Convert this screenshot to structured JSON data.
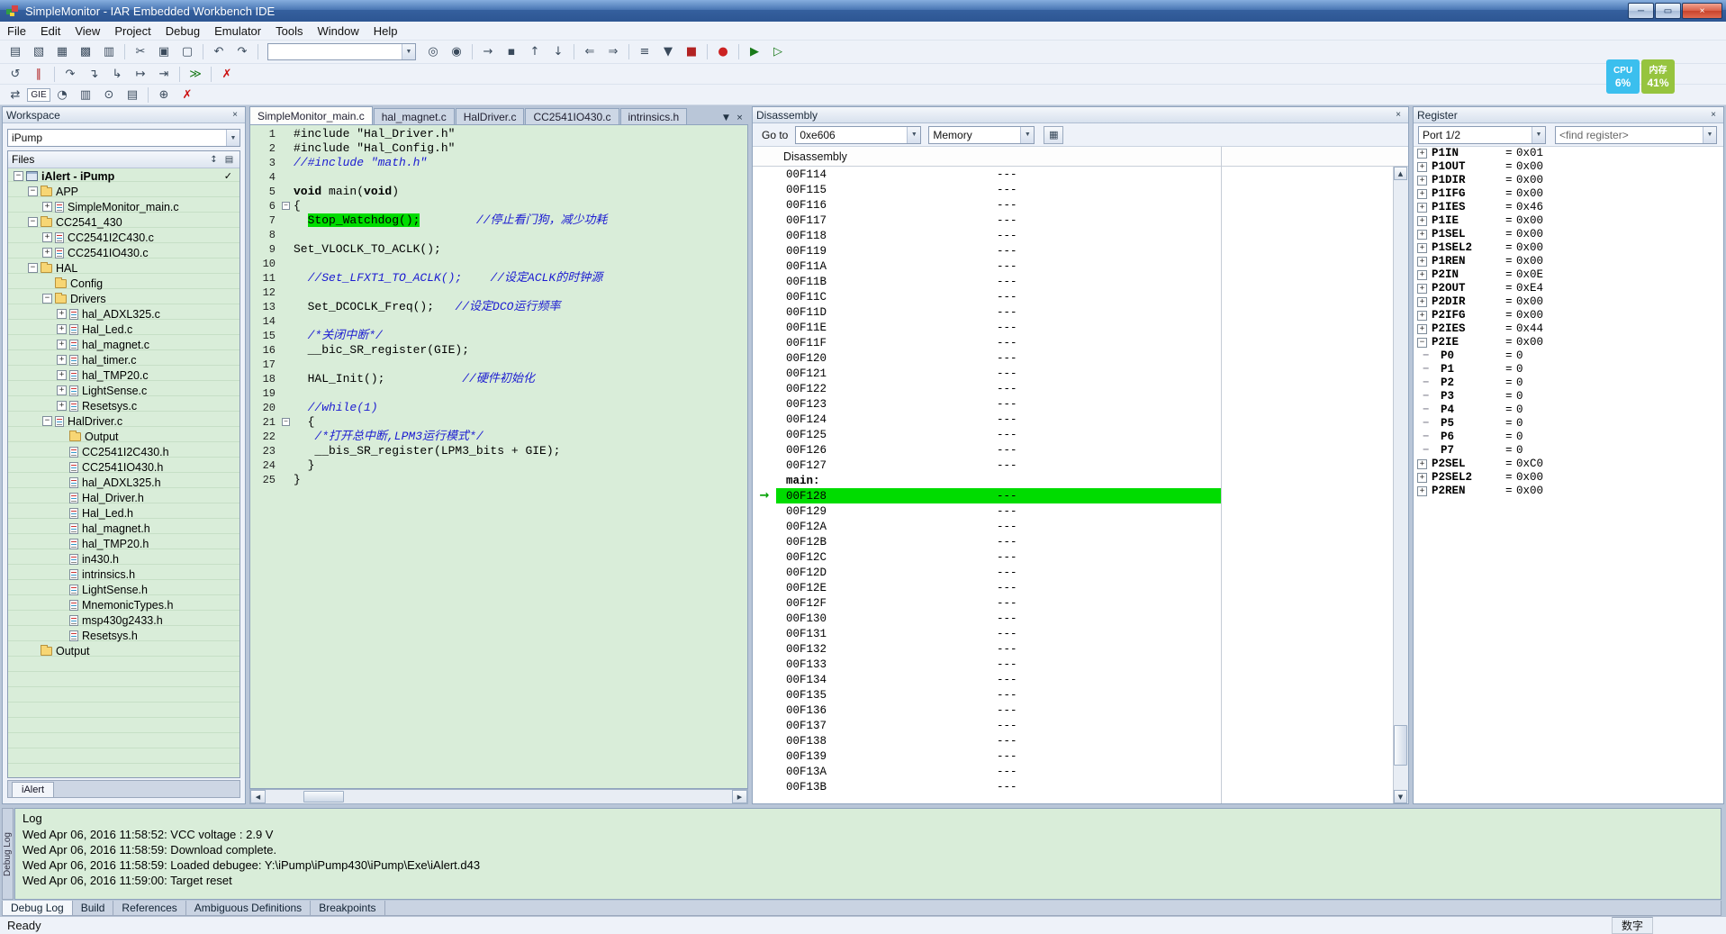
{
  "colors": {
    "execution_highlight": "#00dc00",
    "titlebar_blue": "#35609e",
    "cpu_widget_blue": "#3bbfee",
    "memory_widget_green": "#96c43e"
  },
  "ui": {
    "close_glyph": "×",
    "dropdown_glyph": "▼",
    "up_glyph": "▲",
    "down_glyph": "▼",
    "left_glyph": "◀",
    "right_glyph": "▶",
    "plus_glyph": "+",
    "minus_glyph": "−",
    "arrow_glyph": "→",
    "files_sort_glyph": "↕",
    "files_columns_glyph": "▤",
    "memory_button_glyph": "▦"
  },
  "window": {
    "title": "SimpleMonitor - IAR Embedded Workbench IDE",
    "minimize_glyph": "─",
    "maximize_glyph": "▭",
    "close_glyph": "×"
  },
  "menu": {
    "items": [
      "File",
      "Edit",
      "View",
      "Project",
      "Debug",
      "Emulator",
      "Tools",
      "Window",
      "Help"
    ]
  },
  "sysmon": {
    "cpu_label": "CPU",
    "cpu_value": "6%",
    "memory_label": "内存",
    "memory_value": "41%"
  },
  "toolbar_main": {
    "items": [
      {
        "n": "new-document",
        "g": "▤"
      },
      {
        "n": "open-file",
        "g": "▧"
      },
      {
        "n": "save",
        "g": "▦"
      },
      {
        "n": "save-all",
        "g": "▩"
      },
      {
        "n": "print",
        "g": "▥"
      },
      {
        "sep": true
      },
      {
        "n": "cut",
        "g": "✂"
      },
      {
        "n": "copy",
        "g": "▣"
      },
      {
        "n": "paste",
        "g": "▢"
      },
      {
        "sep": true
      },
      {
        "n": "undo",
        "g": "↶"
      },
      {
        "n": "redo",
        "g": "↷"
      },
      {
        "sep": true
      },
      {
        "combo": true,
        "n": "quick-search",
        "value": ""
      },
      {
        "n": "find",
        "g": "◎"
      },
      {
        "n": "replace",
        "g": "◉"
      },
      {
        "sep": true
      },
      {
        "n": "go-to",
        "g": "→"
      },
      {
        "n": "toggle-bookmark",
        "g": "▪"
      },
      {
        "n": "previous-bookmark",
        "g": "↑"
      },
      {
        "n": "next-bookmark",
        "g": "↓"
      },
      {
        "sep": true
      },
      {
        "n": "navigate-backward",
        "g": "⇐"
      },
      {
        "n": "navigate-forward",
        "g": "⇒"
      },
      {
        "sep": true
      },
      {
        "n": "compile",
        "g": "≡"
      },
      {
        "n": "make",
        "g": "▼"
      },
      {
        "n": "stop-build",
        "g": "■",
        "c": "#b22222"
      },
      {
        "sep": true
      },
      {
        "n": "toggle-breakpoint",
        "g": "●",
        "c": "#cc2222"
      },
      {
        "sep": true
      },
      {
        "n": "download-and-debug",
        "g": "▶",
        "c": "#1a7a1a"
      },
      {
        "n": "debug-without-downloading",
        "g": "▷",
        "c": "#1a7a1a"
      }
    ]
  },
  "toolbar_debug": {
    "items": [
      {
        "n": "reset",
        "g": "↺"
      },
      {
        "n": "break",
        "g": "∥",
        "c": "#b22222"
      },
      {
        "sep": true
      },
      {
        "n": "step-over",
        "g": "↷"
      },
      {
        "n": "step-into",
        "g": "↴"
      },
      {
        "n": "step-out",
        "g": "↳"
      },
      {
        "n": "next-statement",
        "g": "↦"
      },
      {
        "n": "run-to-cursor",
        "g": "⇥"
      },
      {
        "sep": true
      },
      {
        "n": "go",
        "g": "≫",
        "c": "#1a7a1a"
      },
      {
        "sep": true
      },
      {
        "n": "stop-debugging",
        "g": "✗",
        "c": "#cc1111"
      }
    ]
  },
  "toolbar_emulator": {
    "items": [
      {
        "n": "device-control",
        "g": "⇄"
      },
      {
        "n": "gie-toggle",
        "label": "GIE"
      },
      {
        "n": "function-profiler",
        "g": "◔"
      },
      {
        "n": "state-storage",
        "g": "▥"
      },
      {
        "n": "sequencer-control",
        "g": "⊙"
      },
      {
        "n": "power-log",
        "g": "▤"
      },
      {
        "sep": true
      },
      {
        "n": "force-pc",
        "g": "⊕"
      },
      {
        "n": "emulator-stop",
        "g": "✗",
        "c": "#cc1111"
      }
    ]
  },
  "workspace": {
    "title": "Workspace",
    "config": "iPump",
    "files_header": "Files",
    "bottom_tab": "iAlert",
    "tree": [
      {
        "label": "iAlert - iPump",
        "level": 0,
        "icon": "project",
        "expand": "minus",
        "bold": true,
        "check": "✓"
      },
      {
        "label": "APP",
        "level": 1,
        "icon": "folder",
        "expand": "minus"
      },
      {
        "label": "SimpleMonitor_main.c",
        "level": 2,
        "icon": "file",
        "expand": "plus"
      },
      {
        "label": "CC2541_430",
        "level": 1,
        "icon": "folder",
        "expand": "minus"
      },
      {
        "label": "CC2541I2C430.c",
        "level": 2,
        "icon": "file",
        "expand": "plus"
      },
      {
        "label": "CC2541IO430.c",
        "level": 2,
        "icon": "file",
        "expand": "plus"
      },
      {
        "label": "HAL",
        "level": 1,
        "icon": "folder",
        "expand": "minus"
      },
      {
        "label": "Config",
        "level": 2,
        "icon": "folder"
      },
      {
        "label": "Drivers",
        "level": 2,
        "icon": "folder",
        "expand": "minus"
      },
      {
        "label": "hal_ADXL325.c",
        "level": 3,
        "icon": "file",
        "expand": "plus"
      },
      {
        "label": "Hal_Led.c",
        "level": 3,
        "icon": "file",
        "expand": "plus"
      },
      {
        "label": "hal_magnet.c",
        "level": 3,
        "icon": "file",
        "expand": "plus"
      },
      {
        "label": "hal_timer.c",
        "level": 3,
        "icon": "file",
        "expand": "plus"
      },
      {
        "label": "hal_TMP20.c",
        "level": 3,
        "icon": "file",
        "expand": "plus"
      },
      {
        "label": "LightSense.c",
        "level": 3,
        "icon": "file",
        "expand": "plus"
      },
      {
        "label": "Resetsys.c",
        "level": 3,
        "icon": "file",
        "expand": "plus"
      },
      {
        "label": "HalDriver.c",
        "level": 2,
        "icon": "file",
        "expand": "minus"
      },
      {
        "label": "Output",
        "level": 3,
        "icon": "folder"
      },
      {
        "label": "CC2541I2C430.h",
        "level": 3,
        "icon": "file"
      },
      {
        "label": "CC2541IO430.h",
        "level": 3,
        "icon": "file"
      },
      {
        "label": "hal_ADXL325.h",
        "level": 3,
        "icon": "file"
      },
      {
        "label": "Hal_Driver.h",
        "level": 3,
        "icon": "file"
      },
      {
        "label": "Hal_Led.h",
        "level": 3,
        "icon": "file"
      },
      {
        "label": "hal_magnet.h",
        "level": 3,
        "icon": "file"
      },
      {
        "label": "hal_TMP20.h",
        "level": 3,
        "icon": "file"
      },
      {
        "label": "in430.h",
        "level": 3,
        "icon": "file"
      },
      {
        "label": "intrinsics.h",
        "level": 3,
        "icon": "file"
      },
      {
        "label": "LightSense.h",
        "level": 3,
        "icon": "file"
      },
      {
        "label": "MnemonicTypes.h",
        "level": 3,
        "icon": "file"
      },
      {
        "label": "msp430g2433.h",
        "level": 3,
        "icon": "file"
      },
      {
        "label": "Resetsys.h",
        "level": 3,
        "icon": "file"
      },
      {
        "label": "Output",
        "level": 1,
        "icon": "folder"
      }
    ]
  },
  "editor": {
    "tab_list_glyph": "▼",
    "tab_close_glyph": "×",
    "tabs": [
      {
        "label": "SimpleMonitor_main.c",
        "active": true
      },
      {
        "label": "hal_magnet.c"
      },
      {
        "label": "HalDriver.c"
      },
      {
        "label": "CC2541IO430.c"
      },
      {
        "label": "intrinsics.h"
      }
    ],
    "lines": [
      {
        "num": 1,
        "segs": [
          {
            "t": "#include \"Hal_Driver.h\""
          }
        ]
      },
      {
        "num": 2,
        "segs": [
          {
            "t": "#include \"Hal_Config.h\""
          }
        ]
      },
      {
        "num": 3,
        "segs": [
          {
            "c": "c",
            "t": "//#include \"math.h\""
          }
        ]
      },
      {
        "num": 4,
        "segs": []
      },
      {
        "num": 5,
        "segs": [
          {
            "c": "k",
            "t": "void"
          },
          {
            "t": " main("
          },
          {
            "c": "k",
            "t": "void"
          },
          {
            "t": ")"
          }
        ]
      },
      {
        "num": 6,
        "fold": true,
        "segs": [
          {
            "t": "{"
          }
        ]
      },
      {
        "num": 7,
        "segs": [
          {
            "t": "  "
          },
          {
            "c": "h",
            "t": "Stop_Watchdog();"
          },
          {
            "t": "        "
          },
          {
            "c": "c",
            "t": "//停止看门狗，减少功耗"
          }
        ]
      },
      {
        "num": 8,
        "segs": []
      },
      {
        "num": 9,
        "segs": [
          {
            "t": "Set_VLOCLK_TO_ACLK();"
          }
        ]
      },
      {
        "num": 10,
        "segs": []
      },
      {
        "num": 11,
        "segs": [
          {
            "t": "  "
          },
          {
            "c": "c",
            "t": "//Set_LFXT1_TO_ACLK();    //设定ACLK的时钟源"
          }
        ]
      },
      {
        "num": 12,
        "segs": []
      },
      {
        "num": 13,
        "segs": [
          {
            "t": "  Set_DCOCLK_Freq();   "
          },
          {
            "c": "c",
            "t": "//设定DCO运行频率"
          }
        ]
      },
      {
        "num": 14,
        "segs": []
      },
      {
        "num": 15,
        "segs": [
          {
            "t": "  "
          },
          {
            "c": "c",
            "t": "/*关闭中断*/"
          }
        ]
      },
      {
        "num": 16,
        "segs": [
          {
            "t": "  __bic_SR_register(GIE);"
          }
        ]
      },
      {
        "num": 17,
        "segs": []
      },
      {
        "num": 18,
        "segs": [
          {
            "t": "  HAL_Init();           "
          },
          {
            "c": "c",
            "t": "//硬件初始化"
          }
        ]
      },
      {
        "num": 19,
        "segs": []
      },
      {
        "num": 20,
        "segs": [
          {
            "t": "  "
          },
          {
            "c": "c",
            "t": "//while(1)"
          }
        ]
      },
      {
        "num": 21,
        "fold": true,
        "segs": [
          {
            "t": "  {"
          }
        ]
      },
      {
        "num": 22,
        "segs": [
          {
            "t": "   "
          },
          {
            "c": "c",
            "t": "/*打开总中断,LPM3运行模式*/"
          }
        ]
      },
      {
        "num": 23,
        "segs": [
          {
            "t": "   __bis_SR_register(LPM3_bits + GIE);"
          }
        ]
      },
      {
        "num": 24,
        "segs": [
          {
            "t": "  }"
          }
        ]
      },
      {
        "num": 25,
        "segs": [
          {
            "t": "}"
          }
        ]
      }
    ]
  },
  "disassembly": {
    "title": "Disassembly",
    "goto_label": "Go to",
    "goto_value": "0xe606",
    "view_mode": "Memory",
    "column_header": "Disassembly",
    "rows": [
      {
        "addr": "00F114",
        "code": "---"
      },
      {
        "addr": "00F115",
        "code": "---"
      },
      {
        "addr": "00F116",
        "code": "---"
      },
      {
        "addr": "00F117",
        "code": "---"
      },
      {
        "addr": "00F118",
        "code": "---"
      },
      {
        "addr": "00F119",
        "code": "---"
      },
      {
        "addr": "00F11A",
        "code": "---"
      },
      {
        "addr": "00F11B",
        "code": "---"
      },
      {
        "addr": "00F11C",
        "code": "---"
      },
      {
        "addr": "00F11D",
        "code": "---"
      },
      {
        "addr": "00F11E",
        "code": "---"
      },
      {
        "addr": "00F11F",
        "code": "---"
      },
      {
        "addr": "00F120",
        "code": "---"
      },
      {
        "addr": "00F121",
        "code": "---"
      },
      {
        "addr": "00F122",
        "code": "---"
      },
      {
        "addr": "00F123",
        "code": "---"
      },
      {
        "addr": "00F124",
        "code": "---"
      },
      {
        "addr": "00F125",
        "code": "---"
      },
      {
        "addr": "00F126",
        "code": "---"
      },
      {
        "addr": "00F127",
        "code": "---"
      },
      {
        "label": "main:"
      },
      {
        "addr": "00F128",
        "code": "---",
        "current": true
      },
      {
        "addr": "00F129",
        "code": "---"
      },
      {
        "addr": "00F12A",
        "code": "---"
      },
      {
        "addr": "00F12B",
        "code": "---"
      },
      {
        "addr": "00F12C",
        "code": "---"
      },
      {
        "addr": "00F12D",
        "code": "---"
      },
      {
        "addr": "00F12E",
        "code": "---"
      },
      {
        "addr": "00F12F",
        "code": "---"
      },
      {
        "addr": "00F130",
        "code": "---"
      },
      {
        "addr": "00F131",
        "code": "---"
      },
      {
        "addr": "00F132",
        "code": "---"
      },
      {
        "addr": "00F133",
        "code": "---"
      },
      {
        "addr": "00F134",
        "code": "---"
      },
      {
        "addr": "00F135",
        "code": "---"
      },
      {
        "addr": "00F136",
        "code": "---"
      },
      {
        "addr": "00F137",
        "code": "---"
      },
      {
        "addr": "00F138",
        "code": "---"
      },
      {
        "addr": "00F139",
        "code": "---"
      },
      {
        "addr": "00F13A",
        "code": "---"
      },
      {
        "addr": "00F13B",
        "code": "---"
      }
    ]
  },
  "registers": {
    "title": "Register",
    "group": "Port 1/2",
    "find_placeholder": "<find register>",
    "rows": [
      {
        "name": "P1IN",
        "value": "0x01",
        "expand": "plus"
      },
      {
        "name": "P1OUT",
        "value": "0x00",
        "expand": "plus"
      },
      {
        "name": "P1DIR",
        "value": "0x00",
        "expand": "plus"
      },
      {
        "name": "P1IFG",
        "value": "0x00",
        "expand": "plus"
      },
      {
        "name": "P1IES",
        "value": "0x46",
        "expand": "plus"
      },
      {
        "name": "P1IE",
        "value": "0x00",
        "expand": "plus"
      },
      {
        "name": "P1SEL",
        "value": "0x00",
        "expand": "plus"
      },
      {
        "name": "P1SEL2",
        "value": "0x00",
        "expand": "plus"
      },
      {
        "name": "P1REN",
        "value": "0x00",
        "expand": "plus"
      },
      {
        "name": "P2IN",
        "value": "0x0E",
        "expand": "plus"
      },
      {
        "name": "P2OUT",
        "value": "0xE4",
        "expand": "plus"
      },
      {
        "name": "P2DIR",
        "value": "0x00",
        "expand": "plus"
      },
      {
        "name": "P2IFG",
        "value": "0x00",
        "expand": "plus"
      },
      {
        "name": "P2IES",
        "value": "0x44",
        "expand": "plus"
      },
      {
        "name": "P2IE",
        "value": "0x00",
        "expand": "minus"
      },
      {
        "name": "P0",
        "value": "0",
        "level": 1
      },
      {
        "name": "P1",
        "value": "0",
        "level": 1
      },
      {
        "name": "P2",
        "value": "0",
        "level": 1
      },
      {
        "name": "P3",
        "value": "0",
        "level": 1
      },
      {
        "name": "P4",
        "value": "0",
        "level": 1
      },
      {
        "name": "P5",
        "value": "0",
        "level": 1
      },
      {
        "name": "P6",
        "value": "0",
        "level": 1
      },
      {
        "name": "P7",
        "value": "0",
        "level": 1
      },
      {
        "name": "P2SEL",
        "value": "0xC0",
        "expand": "plus"
      },
      {
        "name": "P2SEL2",
        "value": "0x00",
        "expand": "plus"
      },
      {
        "name": "P2REN",
        "value": "0x00",
        "expand": "plus"
      }
    ]
  },
  "log": {
    "side_label": "Debug Log",
    "title": "Log",
    "entries": [
      "Wed Apr 06, 2016 11:58:52: VCC voltage : 2.9 V",
      "Wed Apr 06, 2016 11:58:59: Download complete.",
      "Wed Apr 06, 2016 11:58:59: Loaded debugee: Y:\\iPump\\iPump430\\iPump\\Exe\\iAlert.d43",
      "Wed Apr 06, 2016 11:59:00: Target reset"
    ],
    "tabs": [
      {
        "label": "Debug Log",
        "active": true
      },
      {
        "label": "Build"
      },
      {
        "label": "References"
      },
      {
        "label": "Ambiguous Definitions"
      },
      {
        "label": "Breakpoints"
      }
    ]
  },
  "statusbar": {
    "left": "Ready",
    "num_indicator": "数字"
  }
}
